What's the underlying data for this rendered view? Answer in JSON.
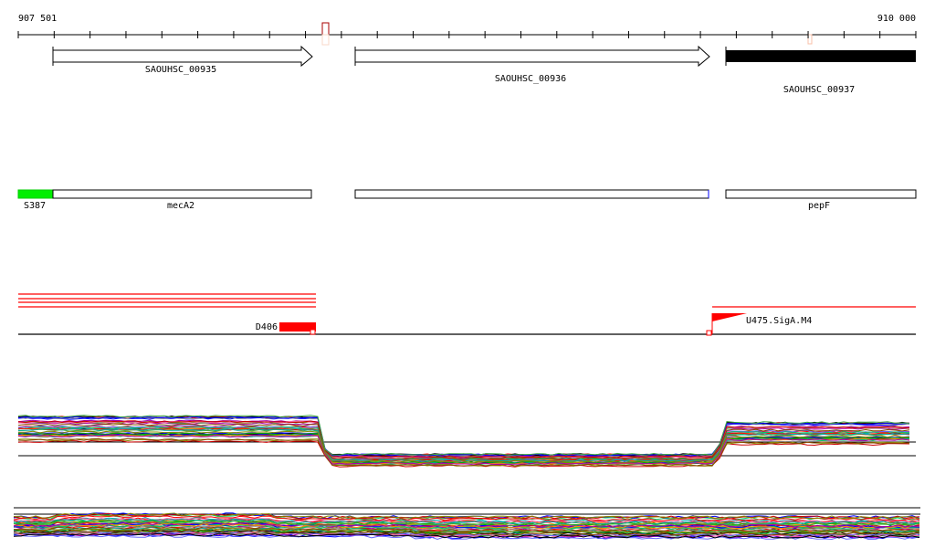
{
  "ruler": {
    "start_label": "907 501",
    "end_label": "910 000"
  },
  "genes": [
    {
      "name": "SAOUHSC_00935",
      "strand": "+",
      "style": "open"
    },
    {
      "name": "SAOUHSC_00936",
      "strand": "+",
      "style": "open"
    },
    {
      "name": "SAOUHSC_00937",
      "strand": "+",
      "style": "filled"
    }
  ],
  "features": [
    {
      "label": "S387",
      "color": "#00ee00"
    },
    {
      "label": "mecA2"
    },
    {
      "label": "pepF"
    }
  ],
  "signals": [
    {
      "label": "D406",
      "color": "#ff0000"
    },
    {
      "label": "U475.SigA.M4",
      "color": "#ff0000"
    }
  ],
  "palette": [
    "#000000",
    "#ff0000",
    "#00aa00",
    "#0000ff",
    "#ff8800",
    "#aa00aa",
    "#00aaaa",
    "#888800",
    "#884400",
    "#44aa44",
    "#ff66aa",
    "#6666ff",
    "#999999",
    "#cc0000",
    "#00cc66"
  ]
}
